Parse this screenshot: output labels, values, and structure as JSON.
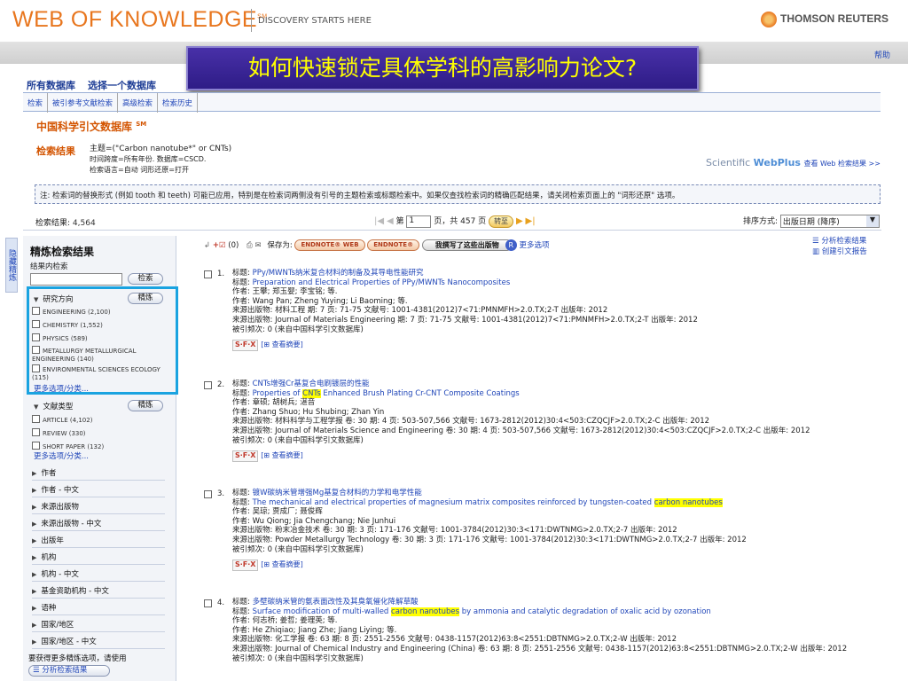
{
  "header": {
    "logo": "WEB OF KNOWLEDGE",
    "logo_sm": "SM",
    "tagline": "DISCOVERY STARTS HERE",
    "brand": "THOMSON REUTERS",
    "help": "帮助"
  },
  "banner": "如何快速锁定具体学科的高影响力论文?",
  "db_tabs": [
    "所有数据库",
    "选择一个数据库"
  ],
  "sub_nav": [
    "检索",
    "被引参考文献检索",
    "高级检索",
    "检索历史"
  ],
  "db_title": "中国科学引文数据库",
  "db_title_sm": "SM",
  "results_label": "检索结果",
  "query": {
    "line1": "主题=(\"Carbon nanotube*\" or CNTs)",
    "line2": "时间跨度=所有年份. 数据库=CSCD.",
    "line3": "检索语言=自动  词形还原=打开"
  },
  "webplus": {
    "prefix": "Scientific",
    "brand": "WebPlus",
    "link": "查看 Web 检索结果 >>"
  },
  "note": "注: 检索词的替换形式 (例如 tooth 和 teeth) 可能已应用，特别是在检索词两侧没有引号的主题检索或标题检索中。如果仅查找检索词的精确匹配结果，请关闭检索页面上的 \"词形还原\" 选项。",
  "result_bar": {
    "count_label": "检索结果:",
    "count": "4,564",
    "page_prefix": "第",
    "page_value": "1",
    "page_suffix": "页，共 457 页",
    "go": "转至",
    "sort_label": "排序方式:",
    "sort_value": "出版日期 (降序)"
  },
  "left_tab": "隐藏精炼",
  "left": {
    "title": "精炼检索结果",
    "within": "结果内检索",
    "search_btn": "检索",
    "refine_btn": "精炼",
    "sec_area": "研究方向",
    "areas": [
      "ENGINEERING (2,100)",
      "CHEMISTRY (1,552)",
      "PHYSICS (589)",
      "METALLURGY METALLURGICAL ENGINEERING (140)",
      "ENVIRONMENTAL SCIENCES ECOLOGY (115)"
    ],
    "more1": "更多选项/分类...",
    "sec_type": "文献类型",
    "types": [
      "ARTICLE (4,102)",
      "REVIEW (330)",
      "SHORT PAPER (132)"
    ],
    "more2": "更多选项/分类...",
    "collapsed": [
      "作者",
      "作者 - 中文",
      "来源出版物",
      "来源出版物 - 中文",
      "出版年",
      "机构",
      "机构 - 中文",
      "基金资助机构 - 中文",
      "语种",
      "国家/地区",
      "国家/地区 - 中文"
    ],
    "tip": "要获得更多精炼选项，请使用",
    "tip_btn": "分析检索结果"
  },
  "toolbar": {
    "count": "(0)",
    "save_as": "保存为:",
    "endnote_web": "ENDNOTE® WEB",
    "endnote": "ENDNOTE®",
    "mine": "我撰写了这些出版物",
    "more": "更多选项"
  },
  "right_tools": [
    "分析检索结果",
    "创建引文报告"
  ],
  "records": [
    {
      "num": "1.",
      "title_zh": "PPy/MWNTs纳米复合材料的制备及其导电性能研究",
      "title_en_parts": [
        "Preparation and Electrical Properties of PPy/MWNTs Nanocomposites"
      ],
      "authors_zh": "王攀; 郑玉婴; 李宝铭; 等.",
      "authors_en": "Wang Pan; Zheng Yuying; Li Baoming; 等.",
      "source_zh": "来源出版物: 材料工程  期: 7  页: 71-75  文献号: 1001-4381(2012)7<71:PMNMFH>2.0.TX;2-T  出版年: 2012",
      "source_en": "来源出版物: Journal of Materials Engineering  期: 7  页: 71-75  文献号: 1001-4381(2012)7<71:PMNMFH>2.0.TX;2-T  出版年: 2012",
      "cited": "被引频次: 0 (来自中国科学引文数据库)",
      "abstract": "查看摘要"
    },
    {
      "num": "2.",
      "title_zh": "CNTs增强Cr基复合电刷镀层的性能",
      "title_en_parts": [
        "Properties of ",
        "CNTs",
        " Enhanced Brush Plating Cr-CNT Composite Coatings"
      ],
      "authors_zh": "章硕; 胡树兵; 湛音",
      "authors_en": "Zhang Shuo; Hu Shubing; Zhan Yin",
      "source_zh": "来源出版物: 材料科学与工程学报  卷: 30  期: 4  页: 503-507,566  文献号: 1673-2812(2012)30:4<503:CZQCJF>2.0.TX;2-C  出版年: 2012",
      "source_en": "来源出版物: Journal of Materials Science and Engineering  卷: 30  期: 4  页: 503-507,566  文献号: 1673-2812(2012)30:4<503:CZQCJF>2.0.TX;2-C  出版年: 2012",
      "cited": "被引频次: 0 (来自中国科学引文数据库)",
      "abstract": "查看摘要"
    },
    {
      "num": "3.",
      "title_zh": "镀W碳纳米管增强Mg基复合材料的力学和电学性能",
      "title_en_parts": [
        "The mechanical and electrical properties of magnesium matrix composites reinforced by tungsten-coated ",
        "carbon nanotubes",
        ""
      ],
      "authors_zh": "吴琼; 贾成厂; 聂俊辉",
      "authors_en": "Wu Qiong; Jia Chengchang; Nie Junhui",
      "source_zh": "来源出版物: 粉末冶金技术  卷: 30  期: 3  页: 171-176  文献号: 1001-3784(2012)30:3<171:DWTNMG>2.0.TX;2-7  出版年: 2012",
      "source_en": "来源出版物: Powder Metallurgy Technology  卷: 30  期: 3  页: 171-176  文献号: 1001-3784(2012)30:3<171:DWTNMG>2.0.TX;2-7  出版年: 2012",
      "cited": "被引频次: 0 (来自中国科学引文数据库)",
      "abstract": "查看摘要"
    },
    {
      "num": "4.",
      "title_zh": "多壁碳纳米管的氨表面改性及其臭氧催化降解草酸",
      "title_en_parts": [
        "Surface modification of multi-walled ",
        "carbon nanotubes",
        " by ammonia and catalytic degradation of oxalic acid by ozonation"
      ],
      "authors_zh": "何志桥; 姜哲; 姜理英; 等.",
      "authors_en": "He Zhiqiao; Jiang Zhe; Jiang Liying; 等.",
      "source_zh": "来源出版物: 化工学报  卷: 63  期: 8  页: 2551-2556  文献号: 0438-1157(2012)63:8<2551:DBTNMG>2.0.TX;2-W  出版年: 2012",
      "source_en": "来源出版物: Journal of Chemical Industry and Engineering (China)  卷: 63  期: 8  页: 2551-2556  文献号: 0438-1157(2012)63:8<2551:DBTNMG>2.0.TX;2-W  出版年: 2012",
      "cited": "被引频次: 0 (来自中国科学引文数据库)"
    }
  ],
  "labels": {
    "title": "标题:",
    "author": "作者:"
  },
  "colors": {
    "accent": "#e8761e",
    "banner": "#3a26a0",
    "highlight": "#ffff00",
    "bluebox": "#1aa3e0"
  }
}
